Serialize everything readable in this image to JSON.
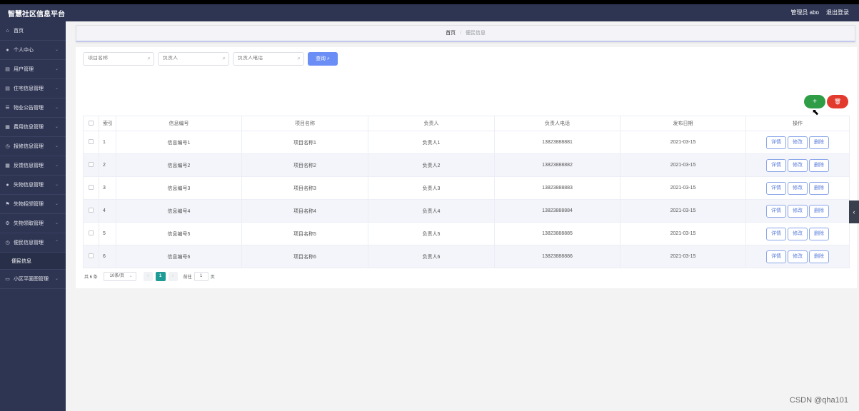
{
  "header": {
    "title": "智慧社区信息平台",
    "user": "管理员 abo",
    "logout": "退出登录"
  },
  "sidebar": {
    "items": [
      {
        "label": "首页",
        "icon": "home-icon",
        "has_children": false
      },
      {
        "label": "个人中心",
        "icon": "user-icon",
        "has_children": true
      },
      {
        "label": "用户管理",
        "icon": "list-icon",
        "has_children": true
      },
      {
        "label": "住宅信息管理",
        "icon": "list-icon",
        "has_children": true
      },
      {
        "label": "物业公告管理",
        "icon": "list-icon",
        "has_children": true
      },
      {
        "label": "费用信息管理",
        "icon": "building-icon",
        "has_children": true
      },
      {
        "label": "报修信息管理",
        "icon": "clock-icon",
        "has_children": true
      },
      {
        "label": "反馈信息管理",
        "icon": "grid-icon",
        "has_children": true
      },
      {
        "label": "失物信息管理",
        "icon": "user-icon",
        "has_children": true
      },
      {
        "label": "失物招领管理",
        "icon": "flag-icon",
        "has_children": true
      },
      {
        "label": "失物领取管理",
        "icon": "gear-icon",
        "has_children": true
      },
      {
        "label": "便民信息管理",
        "icon": "clock-icon",
        "has_children": true,
        "expanded": true
      }
    ],
    "submenu_label": "便民信息",
    "last_item": {
      "label": "小区平面图管理",
      "icon": "monitor-icon"
    }
  },
  "breadcrumb": {
    "home": "首页",
    "separator": "/",
    "current": "便民信息"
  },
  "search": {
    "field1_placeholder": "项目名称",
    "field2_placeholder": "负责人",
    "field3_placeholder": "负责人电话",
    "button_label": "查询"
  },
  "actions": {
    "add": "+",
    "delete": "🗑"
  },
  "table": {
    "headers": [
      "索引",
      "信息编号",
      "项目名称",
      "负责人",
      "负责人电话",
      "发布日期",
      "操作"
    ],
    "rows": [
      {
        "index": "1",
        "code": "信息编号1",
        "name": "项目名称1",
        "person": "负责人1",
        "phone": "13823888881",
        "date": "2021-03-15"
      },
      {
        "index": "2",
        "code": "信息编号2",
        "name": "项目名称2",
        "person": "负责人2",
        "phone": "13823888882",
        "date": "2021-03-15"
      },
      {
        "index": "3",
        "code": "信息编号3",
        "name": "项目名称3",
        "person": "负责人3",
        "phone": "13823888883",
        "date": "2021-03-15"
      },
      {
        "index": "4",
        "code": "信息编号4",
        "name": "项目名称4",
        "person": "负责人4",
        "phone": "13823888884",
        "date": "2021-03-15"
      },
      {
        "index": "5",
        "code": "信息编号5",
        "name": "项目名称5",
        "person": "负责人5",
        "phone": "13823888885",
        "date": "2021-03-15"
      },
      {
        "index": "6",
        "code": "信息编号6",
        "name": "项目名称6",
        "person": "负责人6",
        "phone": "13823888886",
        "date": "2021-03-15"
      }
    ],
    "row_buttons": {
      "detail": "详情",
      "edit": "修改",
      "delete": "删除"
    }
  },
  "pagination": {
    "total": "共 6 条",
    "page_size": "10条/页",
    "prev": "‹",
    "current_page": "1",
    "next": "›",
    "goto_label": "前往",
    "goto_value": "1",
    "goto_suffix": "页"
  },
  "side_tab": "‹",
  "watermark": "CSDN @qha101"
}
